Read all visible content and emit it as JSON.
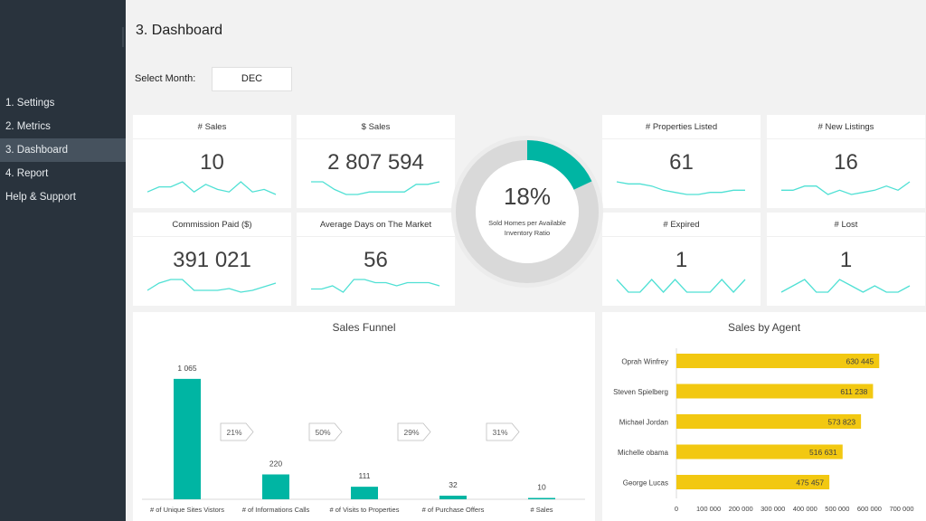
{
  "sidebar": {
    "items": [
      {
        "label": "1. Settings",
        "active": false
      },
      {
        "label": "2. Metrics",
        "active": false
      },
      {
        "label": "3. Dashboard",
        "active": true
      },
      {
        "label": "4. Report",
        "active": false
      },
      {
        "label": "Help & Support",
        "active": false
      }
    ]
  },
  "header": {
    "title": "3. Dashboard",
    "month_label": "Select Month:",
    "month_value": "DEC"
  },
  "colors": {
    "sidebar_bg": "#29333d",
    "sidebar_active": "#46525e",
    "teal": "#00b5a3",
    "sparkline": "#4fe0d4",
    "agent_bar": "#f2c811",
    "donut_track": "#d9d9d9"
  },
  "kpis": [
    {
      "id": "sales-count",
      "title": "# Sales",
      "value": "10",
      "trend": [
        3,
        5,
        5,
        7,
        3,
        6,
        4,
        3,
        7,
        3,
        4,
        2
      ]
    },
    {
      "id": "sales-amount",
      "title": "$ Sales",
      "value": "2 807 594",
      "trend": [
        8,
        8,
        5,
        3,
        3,
        4,
        4,
        4,
        4,
        7,
        7,
        8
      ]
    },
    {
      "id": "properties-listed",
      "title": "# Properties Listed",
      "value": "61",
      "trend": [
        7,
        6.5,
        6.5,
        6,
        5,
        4.5,
        4,
        4,
        4.5,
        4.5,
        5,
        5
      ]
    },
    {
      "id": "new-listings",
      "title": "# New Listings",
      "value": "16",
      "trend": [
        5,
        5,
        7,
        7,
        3,
        5,
        3,
        4,
        5,
        7,
        5,
        9
      ]
    },
    {
      "id": "commission-paid",
      "title": "Commission Paid ($)",
      "value": "391 021",
      "trend": [
        4,
        6,
        7,
        7,
        4,
        4,
        4,
        4.5,
        3.5,
        4,
        5,
        6
      ]
    },
    {
      "id": "avg-days-market",
      "title": "Average Days on The Market",
      "value": "56",
      "trend": [
        4,
        4,
        5,
        3,
        7,
        7,
        6,
        6,
        5,
        6,
        6,
        6,
        5
      ]
    },
    {
      "id": "expired",
      "title": "# Expired",
      "value": "1",
      "trend": [
        1,
        0,
        0,
        1,
        0,
        1,
        0,
        0,
        0,
        1,
        0,
        1
      ]
    },
    {
      "id": "lost",
      "title": "# Lost",
      "value": "1",
      "trend": [
        1,
        2,
        3,
        1,
        1,
        3,
        2,
        1,
        2,
        1,
        1,
        2
      ]
    }
  ],
  "donut": {
    "value_label": "18%",
    "fraction": 0.18,
    "caption_line1": "Sold Homes per Available",
    "caption_line2": "Inventory Ratio"
  },
  "chart_data": [
    {
      "type": "bar",
      "title": "Sales Funnel",
      "categories": [
        "# of Unique Sites Vistors",
        "# of Informations Calls",
        "# of Visits to Properties",
        "# of Purchase Offers",
        "# Sales"
      ],
      "values": [
        1065,
        220,
        111,
        32,
        10
      ],
      "value_labels": [
        "1 065",
        "220",
        "111",
        "32",
        "10"
      ],
      "conversion_labels": [
        "21%",
        "50%",
        "29%",
        "31%"
      ],
      "ylim": [
        0,
        1200
      ],
      "grid": false,
      "xlabel": "",
      "ylabel": ""
    },
    {
      "type": "bar",
      "orientation": "horizontal",
      "title": "Sales by Agent",
      "categories": [
        "Oprah Winfrey",
        "Steven Spielberg",
        "Michael Jordan",
        "Michelle obama",
        "George Lucas"
      ],
      "values": [
        630445,
        611238,
        573823,
        516631,
        475457
      ],
      "value_labels": [
        "630 445",
        "611 238",
        "573 823",
        "516 631",
        "475 457"
      ],
      "xlim": [
        0,
        700000
      ],
      "xticks": [
        0,
        100000,
        200000,
        300000,
        400000,
        500000,
        600000,
        700000
      ],
      "xtick_labels": [
        "0",
        "100 000",
        "200 000",
        "300 000",
        "400 000",
        "500 000",
        "600 000",
        "700 000"
      ],
      "grid": false,
      "xlabel": "",
      "ylabel": ""
    }
  ]
}
